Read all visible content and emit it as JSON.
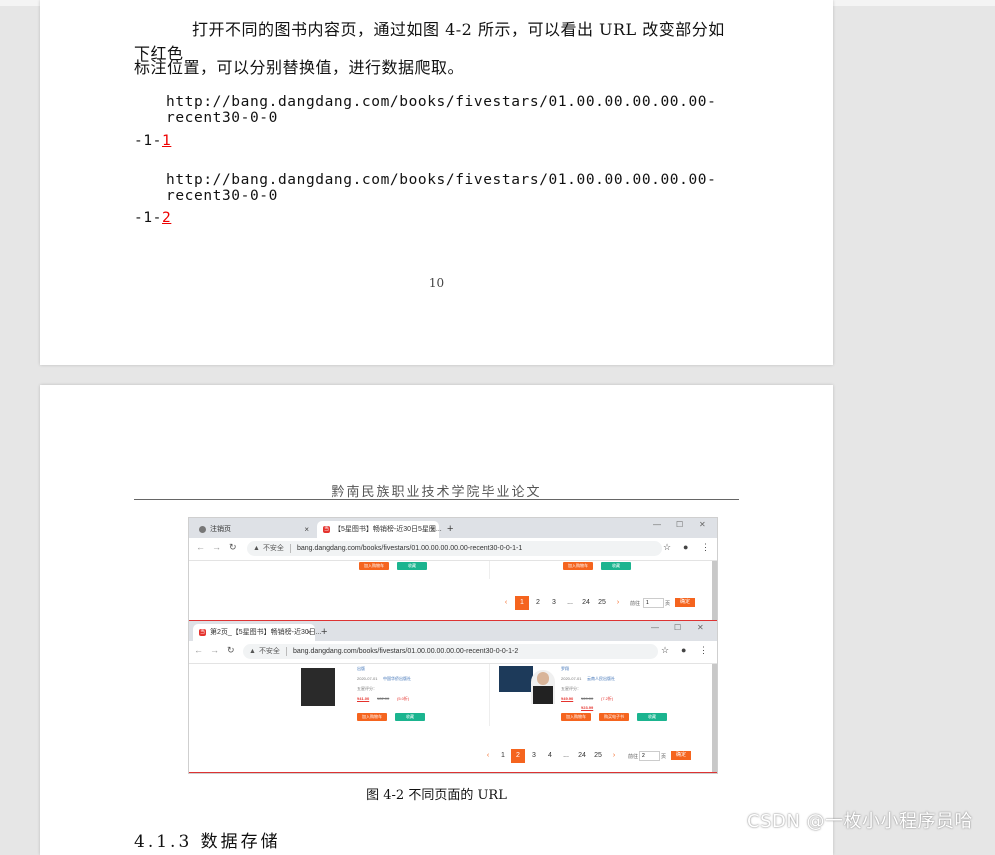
{
  "page1": {
    "paragraph_line1": "打开不同的图书内容页，通过如图 4-2 所示，可以看出 URL 改变部分如下红色",
    "paragraph_line2": "标注位置，可以分别替换值，进行数据爬取。",
    "url1_line1": "http://bang.dangdang.com/books/fivestars/01.00.00.00.00.00-recent30-0-0",
    "url1_line2_prefix": "-1-",
    "url1_highlight": "1",
    "url2_line1": "http://bang.dangdang.com/books/fivestars/01.00.00.00.00.00-recent30-0-0",
    "url2_line2_prefix": "-1-",
    "url2_highlight": "2",
    "page_number": "10"
  },
  "page2": {
    "running_header": "黔南民族职业技术学院毕业论文",
    "figure_caption": "图 4-2 不同页面的 URL",
    "section_heading": "4.1.3  数据存储"
  },
  "figure": {
    "browser1": {
      "tab1_label": "注销页",
      "tab2_label": "【5星图书】畅销榜-近30日5星图...",
      "address_warning": "不安全",
      "url": "bang.dangdang.com/books/fivestars/01.00.00.00.00.00-recent30-0-0-1-1",
      "btn_cart": "加入购物车",
      "btn_fav": "收藏",
      "pages": [
        "1",
        "2",
        "3",
        "...",
        "24",
        "25"
      ],
      "current_page": "1",
      "jump_label": "前往",
      "jump_value": "1",
      "jump_unit": "页",
      "ok_label": "确定"
    },
    "browser2": {
      "tab_label": "第2页_【5星图书】畅销榜-近30日...",
      "address_warning": "不安全",
      "url": "bang.dangdang.com/books/fivestars/01.00.00.00.00.00-recent30-0-0-1-2",
      "item1_publisher": "出版",
      "item1_date": "2020-07-01",
      "item1_press": "中国华侨出版社",
      "item1_stars": "五星评分：",
      "item1_price": "¥41.00",
      "item1_orig": "¥82.00",
      "item1_disc": "(5.0折)",
      "item2_author": "罗翔",
      "item2_date": "2020-07-01",
      "item2_press": "云南人民出版社",
      "item2_stars": "五星评分：",
      "item2_price": "¥49.90",
      "item2_orig": "¥69.00",
      "item2_disc": "(7.2折)",
      "item2_ebook": "¥23.99",
      "btn_cart": "加入购物车",
      "btn_fav": "收藏",
      "btn_buy": "购买电子书",
      "pages": [
        "1",
        "2",
        "3",
        "4",
        "...",
        "24",
        "25"
      ],
      "current_page": "2",
      "jump_label": "前往",
      "jump_value": "2",
      "jump_unit": "页",
      "ok_label": "确定"
    }
  },
  "watermark": "CSDN @一枚小小程序员哈"
}
